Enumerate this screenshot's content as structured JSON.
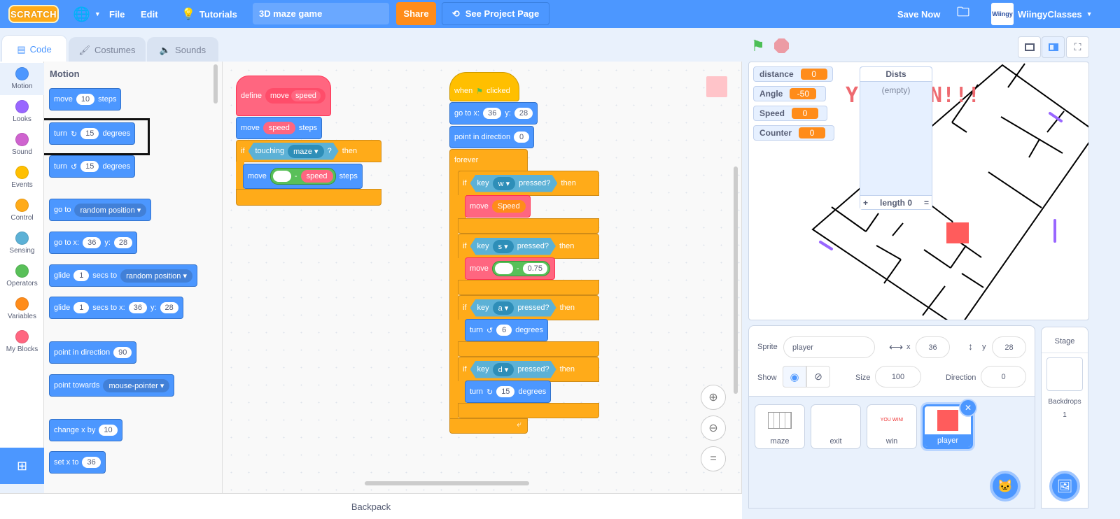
{
  "menu": {
    "logo": "SCRATCH",
    "file": "File",
    "edit": "Edit",
    "tutorials": "Tutorials",
    "project_title": "3D maze game",
    "share": "Share",
    "see_project_page": "See Project Page",
    "save_now": "Save Now",
    "username": "WiingyClasses",
    "accent": "#4c97ff"
  },
  "tabs": [
    {
      "label": "Code"
    },
    {
      "label": "Costumes"
    },
    {
      "label": "Sounds"
    }
  ],
  "categories": [
    {
      "label": "Motion",
      "color": "#4c97ff"
    },
    {
      "label": "Looks",
      "color": "#9966ff"
    },
    {
      "label": "Sound",
      "color": "#cf63cf"
    },
    {
      "label": "Events",
      "color": "#ffbf00"
    },
    {
      "label": "Control",
      "color": "#ffab19"
    },
    {
      "label": "Sensing",
      "color": "#5cb1d6"
    },
    {
      "label": "Operators",
      "color": "#59c059"
    },
    {
      "label": "Variables",
      "color": "#ff8c1a"
    },
    {
      "label": "My Blocks",
      "color": "#ff6680"
    }
  ],
  "palette": {
    "heading": "Motion",
    "blocks": [
      [
        "move",
        "10",
        "steps"
      ],
      [
        "turn",
        "15",
        "degrees"
      ],
      [
        "turn",
        "15",
        "degrees"
      ],
      [
        "go to",
        "random position"
      ],
      [
        "go to x:",
        "36",
        "y:",
        "28"
      ],
      [
        "glide",
        "1",
        "secs to",
        "random position"
      ],
      [
        "glide",
        "1",
        "secs to x:",
        "36",
        "y:",
        "28"
      ],
      [
        "point in direction",
        "90"
      ],
      [
        "point towards",
        "mouse-pointer"
      ],
      [
        "change x by",
        "10"
      ],
      [
        "set x to",
        "36"
      ]
    ]
  },
  "script1": {
    "define": "define",
    "name": "move",
    "param": "speed",
    "move": "move",
    "steps": "steps",
    "if": "if",
    "touching": "touching",
    "maze": "maze",
    "q": "?",
    "then": "then",
    "minus": "-"
  },
  "script2": {
    "when": "when",
    "clicked": "clicked",
    "goto_x": "go to x:",
    "x": "36",
    "y_label": "y:",
    "y": "28",
    "point_dir": "point in direction",
    "dir": "0",
    "forever": "forever",
    "if": "if",
    "key": "key",
    "pressed": "pressed?",
    "then": "then",
    "k_w": "w",
    "k_s": "s",
    "k_a": "a",
    "k_d": "d",
    "move": "move",
    "speed_var": "Speed",
    "minus": "-",
    "back": "0.75",
    "turn": "turn",
    "a_deg": "6",
    "d_deg": "15",
    "degrees": "degrees"
  },
  "stage": {
    "monitors": [
      {
        "label": "distance",
        "value": "0"
      },
      {
        "label": "Angle",
        "value": "-50"
      },
      {
        "label": "Speed",
        "value": "0"
      },
      {
        "label": "Counter",
        "value": "0"
      }
    ],
    "list": {
      "title": "Dists",
      "empty": "(empty)",
      "add": "+",
      "length": "length 0",
      "resize": "="
    },
    "win_text_left": "Y",
    "win_text_right": "N!!!"
  },
  "sprite_info": {
    "sprite_label": "Sprite",
    "sprite_name": "player",
    "x_label": "x",
    "x": "36",
    "y_label": "y",
    "y": "28",
    "show_label": "Show",
    "size_label": "Size",
    "size": "100",
    "direction_label": "Direction",
    "direction": "0"
  },
  "sprites": [
    {
      "name": "maze"
    },
    {
      "name": "exit"
    },
    {
      "name": "win",
      "thumb_text": "YOU WIN!"
    },
    {
      "name": "player",
      "selected": true
    }
  ],
  "stage_panel": {
    "title": "Stage",
    "backdrops_label": "Backdrops",
    "backdrops": "1"
  },
  "backpack": "Backpack"
}
